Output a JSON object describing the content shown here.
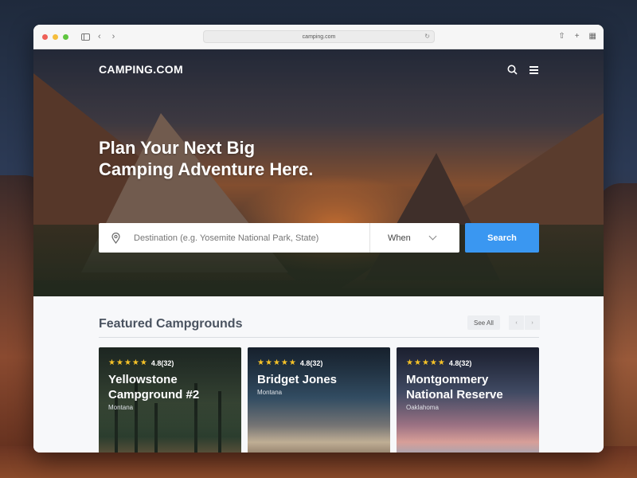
{
  "browser": {
    "url": "camping.com"
  },
  "site": {
    "brand": "CAMPING.COM"
  },
  "hero": {
    "headline_line1": "Plan Your Next Big",
    "headline_line2": "Camping Adventure Here."
  },
  "search": {
    "destination_placeholder": "Destination (e.g. Yosemite National Park, State)",
    "when_label": "When",
    "button_label": "Search"
  },
  "featured": {
    "title": "Featured Campgrounds",
    "see_all_label": "See All",
    "cards": [
      {
        "rating": "4.8(32)",
        "stars": 5,
        "name": "Yellowstone Campground #2",
        "location": "Montana"
      },
      {
        "rating": "4.8(32)",
        "stars": 5,
        "name": "Bridget Jones",
        "location": "Montana"
      },
      {
        "rating": "4.8(32)",
        "stars": 5,
        "name": "Montgommery National Reserve",
        "location": "Oaklahoma"
      }
    ]
  },
  "colors": {
    "accent": "#3a97f1",
    "star": "#f6c228"
  },
  "icons": [
    "sidebar-icon",
    "back-icon",
    "forward-icon",
    "reload-icon",
    "share-icon",
    "new-tab-icon",
    "tabs-icon",
    "search-icon",
    "menu-icon",
    "location-pin-icon",
    "chevron-down-icon",
    "star-icon"
  ]
}
